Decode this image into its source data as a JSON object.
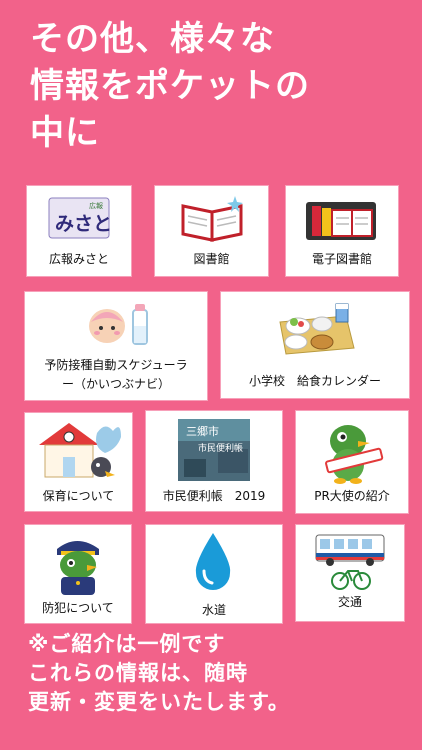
{
  "headline": "その他、様々な\n情報をポケットの\n中に",
  "logo_text": {
    "small": "広報",
    "big": "みさと"
  },
  "tiles": [
    {
      "label": "広報みさと",
      "icon": "magazine-logo-icon"
    },
    {
      "label": "図書館",
      "icon": "open-book-icon"
    },
    {
      "label": "電子図書館",
      "icon": "books-shelf-icon"
    },
    {
      "label": "予防接種自動スケジューラ\nー（かいつぶナビ）",
      "icon": "baby-bottle-icon"
    },
    {
      "label": "小学校　給食カレンダー",
      "icon": "school-lunch-tray-icon"
    },
    {
      "label": "保育について",
      "icon": "nursery-house-icon"
    },
    {
      "label": "市民便利帳　2019",
      "icon": "handbook-cover-icon"
    },
    {
      "label": "PR大使の紹介",
      "icon": "mascot-bird-icon"
    },
    {
      "label": "防犯について",
      "icon": "police-mascot-icon"
    },
    {
      "label": "水道",
      "icon": "water-drop-icon"
    },
    {
      "label": "交通",
      "icon": "bus-bicycle-icon"
    }
  ],
  "handbook_cover_text": {
    "title": "三郷市",
    "subtitle": "市民便利帳"
  },
  "footer": "※ご紹介は一例です\nこれらの情報は、随時\n更新・変更をいたします。"
}
